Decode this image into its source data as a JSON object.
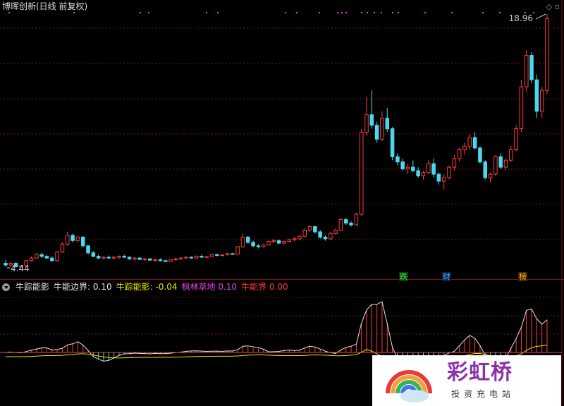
{
  "header": {
    "title": "博晖创新(日线 前复权)",
    "high_label": "18.96",
    "low_label": "4.44",
    "controls": "◇ ▫"
  },
  "indicator": {
    "name": "牛踪能影",
    "items": [
      {
        "label": "牛能边界:",
        "value": "0.10",
        "color": "#e6e6e6"
      },
      {
        "label": "牛踪能影:",
        "value": "-0.04",
        "color": "#e8e800"
      },
      {
        "label": "枫林草地",
        "value": "0.10",
        "color": "#e040e0"
      },
      {
        "label": "牛能界",
        "value": "0.00",
        "color": "#ff3c3c"
      }
    ]
  },
  "tags": [
    {
      "text": "跌",
      "color": "#40e040",
      "bg": "#0a3a0a"
    },
    {
      "text": "财",
      "color": "#4aa8ff",
      "bg": "#0a1e3a"
    },
    {
      "text": "榜",
      "color": "#ffb030",
      "bg": "#3a2400"
    }
  ],
  "watermark": {
    "brand": "彩虹桥",
    "sub": "投资充电站"
  },
  "colors": {
    "up": "#ff3c3c",
    "down": "#4ad8ee",
    "grid": "#7a1212",
    "osc_line": "#e8e800",
    "energy_line": "#e6e6e6",
    "marker": "#e040e0"
  },
  "chart_data": {
    "type": "candlestick",
    "price_range": [
      4.44,
      18.96
    ],
    "candles": [
      [
        4.7,
        4.9,
        4.5,
        4.6
      ],
      [
        4.6,
        4.8,
        4.5,
        4.7
      ],
      [
        4.7,
        4.75,
        4.45,
        4.5
      ],
      [
        4.5,
        4.6,
        4.44,
        4.55
      ],
      [
        4.55,
        4.9,
        4.5,
        4.85
      ],
      [
        4.85,
        5.1,
        4.8,
        5.0
      ],
      [
        5.0,
        5.3,
        4.95,
        5.2
      ],
      [
        5.2,
        5.3,
        5.0,
        5.1
      ],
      [
        5.1,
        5.2,
        4.95,
        5.0
      ],
      [
        5.0,
        5.1,
        4.8,
        4.85
      ],
      [
        4.85,
        5.4,
        4.8,
        5.35
      ],
      [
        5.35,
        5.9,
        5.3,
        5.8
      ],
      [
        5.8,
        6.5,
        5.7,
        6.3
      ],
      [
        6.3,
        6.4,
        5.9,
        6.0
      ],
      [
        6.0,
        6.3,
        5.9,
        6.2
      ],
      [
        6.2,
        6.25,
        5.6,
        5.7
      ],
      [
        5.7,
        5.75,
        5.2,
        5.3
      ],
      [
        5.3,
        5.4,
        5.05,
        5.1
      ],
      [
        5.1,
        5.2,
        4.95,
        5.0
      ],
      [
        5.0,
        5.1,
        4.9,
        5.05
      ],
      [
        5.05,
        5.15,
        4.95,
        5.0
      ],
      [
        5.0,
        5.1,
        4.9,
        5.05
      ],
      [
        5.05,
        5.15,
        4.95,
        5.1
      ],
      [
        5.1,
        5.2,
        5.0,
        5.05
      ],
      [
        5.05,
        5.1,
        4.9,
        4.95
      ],
      [
        4.95,
        5.05,
        4.85,
        5.0
      ],
      [
        5.0,
        5.05,
        4.9,
        4.92
      ],
      [
        4.92,
        5.0,
        4.85,
        4.95
      ],
      [
        4.95,
        5.0,
        4.85,
        4.88
      ],
      [
        4.88,
        4.95,
        4.8,
        4.9
      ],
      [
        4.9,
        4.98,
        4.82,
        4.85
      ],
      [
        4.85,
        4.9,
        4.78,
        4.8
      ],
      [
        4.8,
        4.95,
        4.78,
        4.92
      ],
      [
        4.92,
        5.0,
        4.85,
        4.95
      ],
      [
        4.95,
        5.05,
        4.9,
        5.0
      ],
      [
        5.0,
        5.1,
        4.95,
        5.05
      ],
      [
        5.05,
        5.1,
        4.95,
        5.0
      ],
      [
        5.0,
        5.15,
        4.98,
        5.1
      ],
      [
        5.1,
        5.2,
        5.0,
        5.05
      ],
      [
        5.05,
        5.1,
        5.0,
        5.08
      ],
      [
        5.08,
        5.25,
        5.05,
        5.2
      ],
      [
        5.2,
        5.25,
        5.1,
        5.15
      ],
      [
        5.15,
        5.2,
        5.1,
        5.18
      ],
      [
        5.18,
        5.3,
        5.15,
        5.25
      ],
      [
        5.25,
        5.3,
        5.2,
        5.22
      ],
      [
        5.22,
        5.7,
        5.2,
        5.65
      ],
      [
        5.65,
        6.4,
        5.6,
        6.2
      ],
      [
        6.2,
        6.25,
        5.8,
        5.9
      ],
      [
        5.9,
        6.0,
        5.6,
        5.7
      ],
      [
        5.7,
        5.8,
        5.55,
        5.65
      ],
      [
        5.65,
        5.8,
        5.6,
        5.75
      ],
      [
        5.75,
        6.0,
        5.7,
        5.95
      ],
      [
        5.95,
        6.1,
        5.85,
        6.0
      ],
      [
        6.0,
        6.05,
        5.8,
        5.85
      ],
      [
        5.85,
        6.0,
        5.8,
        5.95
      ],
      [
        5.95,
        6.1,
        5.9,
        6.05
      ],
      [
        6.05,
        6.2,
        5.95,
        6.1
      ],
      [
        6.1,
        6.3,
        6.0,
        6.25
      ],
      [
        6.25,
        6.7,
        6.2,
        6.6
      ],
      [
        6.6,
        6.9,
        6.5,
        6.8
      ],
      [
        6.8,
        6.85,
        6.4,
        6.5
      ],
      [
        6.5,
        6.6,
        6.1,
        6.2
      ],
      [
        6.2,
        6.3,
        6.0,
        6.1
      ],
      [
        6.1,
        6.5,
        6.05,
        6.4
      ],
      [
        6.4,
        6.7,
        6.35,
        6.6
      ],
      [
        6.6,
        7.3,
        6.55,
        7.2
      ],
      [
        7.2,
        7.3,
        6.9,
        7.0
      ],
      [
        7.0,
        7.1,
        6.8,
        6.9
      ],
      [
        6.9,
        7.6,
        6.85,
        7.5
      ],
      [
        7.5,
        12.4,
        7.4,
        12.2
      ],
      [
        12.2,
        14.2,
        12.0,
        13.2
      ],
      [
        13.2,
        14.6,
        12.4,
        12.6
      ],
      [
        12.6,
        12.8,
        11.6,
        11.8
      ],
      [
        11.8,
        13.4,
        11.7,
        13.0
      ],
      [
        13.0,
        13.6,
        12.2,
        12.4
      ],
      [
        12.4,
        12.5,
        10.6,
        10.8
      ],
      [
        10.8,
        11.0,
        10.3,
        10.5
      ],
      [
        10.5,
        10.7,
        10.0,
        10.1
      ],
      [
        10.1,
        10.4,
        9.8,
        10.2
      ],
      [
        10.2,
        10.6,
        9.9,
        10.0
      ],
      [
        10.0,
        10.2,
        9.6,
        9.7
      ],
      [
        9.7,
        10.0,
        9.5,
        9.9
      ],
      [
        9.9,
        10.6,
        9.8,
        10.4
      ],
      [
        10.4,
        10.7,
        9.6,
        9.8
      ],
      [
        9.8,
        9.9,
        9.2,
        9.4
      ],
      [
        9.4,
        9.8,
        8.9,
        9.6
      ],
      [
        9.6,
        10.3,
        9.5,
        10.2
      ],
      [
        10.2,
        10.9,
        10.0,
        10.7
      ],
      [
        10.7,
        11.3,
        10.5,
        11.2
      ],
      [
        11.2,
        11.6,
        10.9,
        11.4
      ],
      [
        11.4,
        12.1,
        11.2,
        11.9
      ],
      [
        11.9,
        12.2,
        11.2,
        11.3
      ],
      [
        11.3,
        11.4,
        10.4,
        10.5
      ],
      [
        10.5,
        10.6,
        9.5,
        9.6
      ],
      [
        9.6,
        9.9,
        9.3,
        9.8
      ],
      [
        9.8,
        10.9,
        9.7,
        10.8
      ],
      [
        10.8,
        11.0,
        10.1,
        10.2
      ],
      [
        10.2,
        10.7,
        10.0,
        10.6
      ],
      [
        10.6,
        11.4,
        10.5,
        11.2
      ],
      [
        11.2,
        12.6,
        11.1,
        12.4
      ],
      [
        12.4,
        15.2,
        12.2,
        14.8
      ],
      [
        14.8,
        16.9,
        14.5,
        16.6
      ],
      [
        16.6,
        16.8,
        15.0,
        15.2
      ],
      [
        15.2,
        15.5,
        13.0,
        13.4
      ],
      [
        13.4,
        14.8,
        13.0,
        14.6
      ],
      [
        14.6,
        18.96,
        14.4,
        18.7
      ]
    ],
    "oscillator": {
      "names": [
        "牛能边界",
        "牛踪能影",
        "枫林草地",
        "牛能界"
      ],
      "last_values": [
        0.1,
        -0.04,
        0.1,
        0.0
      ]
    }
  }
}
